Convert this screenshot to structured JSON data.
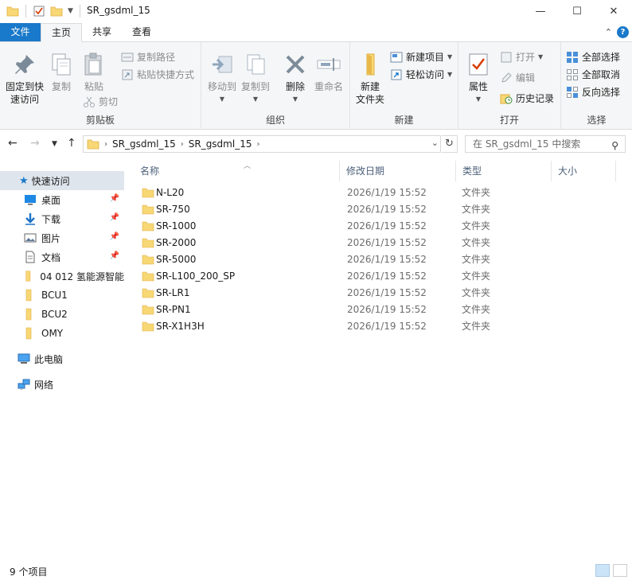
{
  "window": {
    "title": "SR_gsdml_15",
    "controls": {
      "minimize": "—",
      "maximize": "☐",
      "close": "✕"
    }
  },
  "ribbon_tabs": [
    {
      "label": "文件"
    },
    {
      "label": "主页"
    },
    {
      "label": "共享"
    },
    {
      "label": "查看"
    }
  ],
  "ribbon": {
    "clipboard": {
      "label": "剪贴板",
      "pin": "固定到快速访问",
      "pin_line1": "固定到快",
      "pin_line2": "速访问",
      "copy": "复制",
      "paste": "粘贴",
      "copy_path": "复制路径",
      "paste_shortcut": "粘贴快捷方式",
      "cut": "剪切"
    },
    "organize": {
      "label": "组织",
      "move_to": "移动到",
      "copy_to": "复制到",
      "delete": "删除",
      "rename": "重命名"
    },
    "new": {
      "label": "新建",
      "new_item": "新建项目",
      "easy_access": "轻松访问",
      "new_folder_line1": "新建",
      "new_folder_line2": "文件夹"
    },
    "open": {
      "label": "打开",
      "properties": "属性",
      "open": "打开",
      "edit": "编辑",
      "history": "历史记录"
    },
    "select": {
      "label": "选择",
      "select_all": "全部选择",
      "select_none": "全部取消",
      "invert": "反向选择"
    }
  },
  "address_bar": {
    "crumbs": [
      "SR_gsdml_15",
      "SR_gsdml_15"
    ],
    "search_placeholder": "在 SR_gsdml_15 中搜索"
  },
  "nav_pane": {
    "quick_access": "快速访问",
    "items": [
      {
        "label": "桌面",
        "pinned": true
      },
      {
        "label": "下载",
        "pinned": true
      },
      {
        "label": "图片",
        "pinned": true
      },
      {
        "label": "文档",
        "pinned": true
      },
      {
        "label": "04 012 氢能源智能",
        "pinned": false
      },
      {
        "label": "BCU1",
        "pinned": false
      },
      {
        "label": "BCU2",
        "pinned": false
      },
      {
        "label": "OMY",
        "pinned": false
      }
    ],
    "this_pc": "此电脑",
    "network": "网络"
  },
  "columns": {
    "name": "名称",
    "date": "修改日期",
    "type": "类型",
    "size": "大小"
  },
  "files": [
    {
      "name": "N-L20",
      "date": "2026/1/19 15:52",
      "type": "文件夹"
    },
    {
      "name": "SR-750",
      "date": "2026/1/19 15:52",
      "type": "文件夹"
    },
    {
      "name": "SR-1000",
      "date": "2026/1/19 15:52",
      "type": "文件夹"
    },
    {
      "name": "SR-2000",
      "date": "2026/1/19 15:52",
      "type": "文件夹"
    },
    {
      "name": "SR-5000",
      "date": "2026/1/19 15:52",
      "type": "文件夹"
    },
    {
      "name": "SR-L100_200_SP",
      "date": "2026/1/19 15:52",
      "type": "文件夹"
    },
    {
      "name": "SR-LR1",
      "date": "2026/1/19 15:52",
      "type": "文件夹"
    },
    {
      "name": "SR-PN1",
      "date": "2026/1/19 15:52",
      "type": "文件夹"
    },
    {
      "name": "SR-X1H3H",
      "date": "2026/1/19 15:52",
      "type": "文件夹"
    }
  ],
  "status": {
    "item_count": "9 个项目"
  },
  "colors": {
    "accent": "#1979ca",
    "folder": "#f8d775",
    "folder_dark": "#e8b84a"
  }
}
